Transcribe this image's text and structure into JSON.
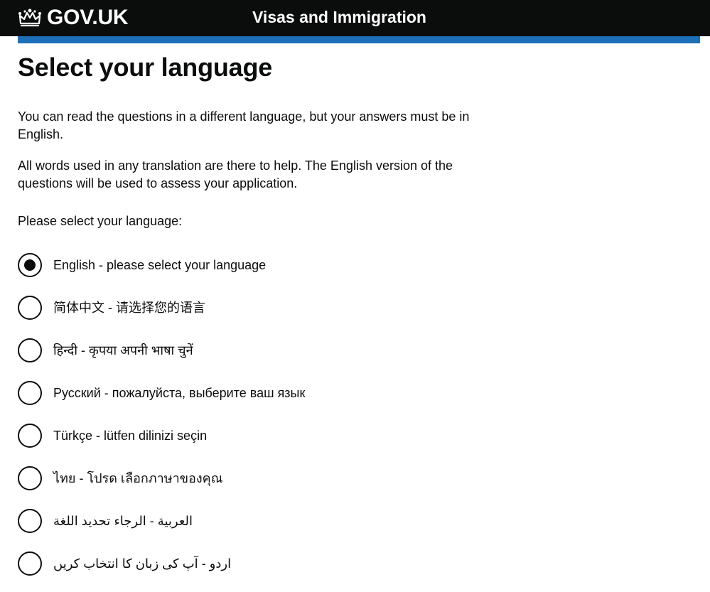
{
  "header": {
    "brand": "GOV.UK",
    "service": "Visas and Immigration"
  },
  "main": {
    "title": "Select your language",
    "intro1": "You can read the questions in a different language, but your answers must be in English.",
    "intro2": "All words used in any translation are there to help. The English version of the questions will be used to assess your application.",
    "prompt": "Please select your language:",
    "options": [
      {
        "label": "English - please select your language",
        "selected": true
      },
      {
        "label": "简体中文 - 请选择您的语言",
        "selected": false
      },
      {
        "label": "हिन्दी - कृपया अपनी भाषा चुनें",
        "selected": false
      },
      {
        "label": "Русский - пожалуйста, выберите ваш язык",
        "selected": false
      },
      {
        "label": "Türkçe - lütfen dilinizi seçin",
        "selected": false
      },
      {
        "label": "ไทย - โปรด เลือกภาษาของคุณ",
        "selected": false
      },
      {
        "label": "العربية - الرجاء تحديد اللغة",
        "selected": false
      },
      {
        "label": "اردو - آپ کی زبان کا انتخاب کریں",
        "selected": false
      }
    ]
  }
}
